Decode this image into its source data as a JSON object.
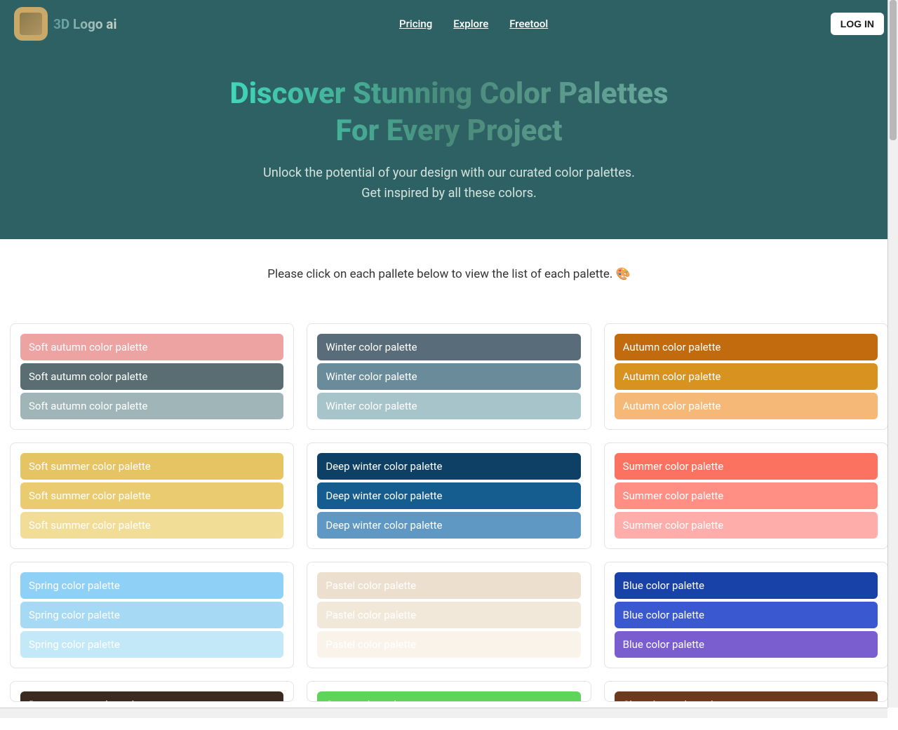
{
  "brand": "3D Logo ai",
  "nav": {
    "pricing": "Pricing",
    "explore": "Explore",
    "freetool": "Freetool",
    "login": "LOG IN"
  },
  "hero": {
    "title": "Discover Stunning Color Palettes For Every Project",
    "subtitle": "Unlock the potential of your design with our curated color palettes. Get inspired by all these colors."
  },
  "instruction": "Please click on each pallete below to view the list of each palette. 🎨",
  "palettes": [
    {
      "name": "Soft autumn color palette",
      "colors": [
        "#eda3a1",
        "#5a6d72",
        "#a0b5b8"
      ]
    },
    {
      "name": "Winter color palette",
      "colors": [
        "#586d79",
        "#6a8b99",
        "#a6c4c9"
      ]
    },
    {
      "name": "Autumn color palette",
      "colors": [
        "#c16a0e",
        "#d8921f",
        "#f6b877"
      ]
    },
    {
      "name": "Soft summer color palette",
      "colors": [
        "#e7c463",
        "#ebcb6f",
        "#f2dd96"
      ]
    },
    {
      "name": "Deep winter color palette",
      "colors": [
        "#0e4066",
        "#155c8f",
        "#5e98c3"
      ]
    },
    {
      "name": "Summer color palette",
      "colors": [
        "#fb7360",
        "#ff8e84",
        "#ffadaa"
      ]
    },
    {
      "name": "Spring color palette",
      "colors": [
        "#8fd1f6",
        "#a6daf4",
        "#c3e8f8"
      ]
    },
    {
      "name": "Pastel color palette",
      "colors": [
        "#ecdfcd",
        "#f2e8d9",
        "#f9f3ea"
      ]
    },
    {
      "name": "Blue color palette",
      "colors": [
        "#1842a8",
        "#3a58d0",
        "#7a5ed0"
      ]
    }
  ],
  "partial_row": [
    {
      "name": "Deep autumn color palette",
      "color": "#3b2a1f"
    },
    {
      "name": "Green color palette",
      "color": "#5fd45a"
    },
    {
      "name": "Chocolate color palette",
      "color": "#6e3a1e"
    }
  ]
}
